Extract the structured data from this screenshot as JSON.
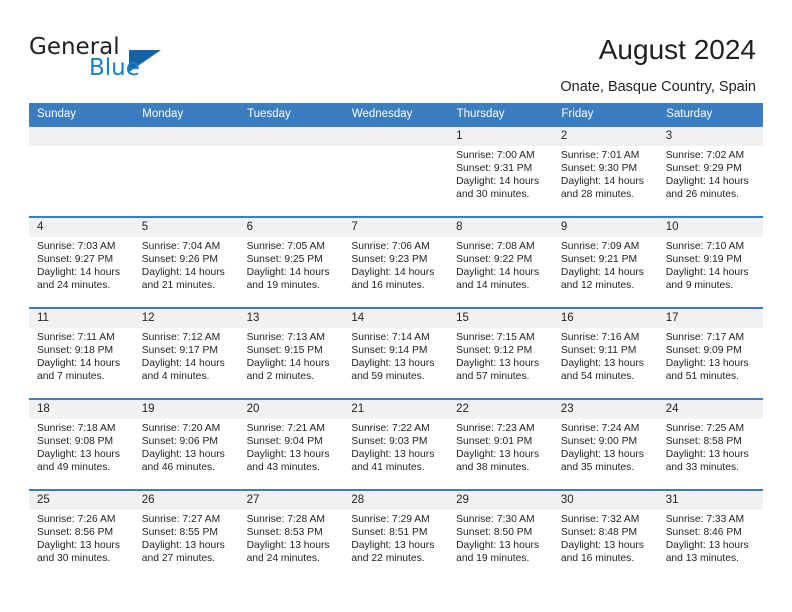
{
  "brand": {
    "name_part1": "General",
    "name_part2": "Blue",
    "triangle_color": "#1464a5",
    "blue_text_color": "#1c7fc4"
  },
  "header": {
    "title": "August 2024",
    "subtitle": "Onate, Basque Country, Spain"
  },
  "theme": {
    "header_row_bg": "#3b7dc0",
    "header_row_text": "#ffffff",
    "daynum_bg": "#f1f1f1",
    "row_divider": "#3b7dc0",
    "body_text": "#231f20"
  },
  "weekday_headers": [
    "Sunday",
    "Monday",
    "Tuesday",
    "Wednesday",
    "Thursday",
    "Friday",
    "Saturday"
  ],
  "weeks": [
    [
      {
        "day": "",
        "empty": true
      },
      {
        "day": "",
        "empty": true
      },
      {
        "day": "",
        "empty": true
      },
      {
        "day": "",
        "empty": true
      },
      {
        "day": "1",
        "sunrise": "Sunrise: 7:00 AM",
        "sunset": "Sunset: 9:31 PM",
        "daylight_line1": "Daylight: 14 hours",
        "daylight_line2": "and 30 minutes."
      },
      {
        "day": "2",
        "sunrise": "Sunrise: 7:01 AM",
        "sunset": "Sunset: 9:30 PM",
        "daylight_line1": "Daylight: 14 hours",
        "daylight_line2": "and 28 minutes."
      },
      {
        "day": "3",
        "sunrise": "Sunrise: 7:02 AM",
        "sunset": "Sunset: 9:29 PM",
        "daylight_line1": "Daylight: 14 hours",
        "daylight_line2": "and 26 minutes."
      }
    ],
    [
      {
        "day": "4",
        "sunrise": "Sunrise: 7:03 AM",
        "sunset": "Sunset: 9:27 PM",
        "daylight_line1": "Daylight: 14 hours",
        "daylight_line2": "and 24 minutes."
      },
      {
        "day": "5",
        "sunrise": "Sunrise: 7:04 AM",
        "sunset": "Sunset: 9:26 PM",
        "daylight_line1": "Daylight: 14 hours",
        "daylight_line2": "and 21 minutes."
      },
      {
        "day": "6",
        "sunrise": "Sunrise: 7:05 AM",
        "sunset": "Sunset: 9:25 PM",
        "daylight_line1": "Daylight: 14 hours",
        "daylight_line2": "and 19 minutes."
      },
      {
        "day": "7",
        "sunrise": "Sunrise: 7:06 AM",
        "sunset": "Sunset: 9:23 PM",
        "daylight_line1": "Daylight: 14 hours",
        "daylight_line2": "and 16 minutes."
      },
      {
        "day": "8",
        "sunrise": "Sunrise: 7:08 AM",
        "sunset": "Sunset: 9:22 PM",
        "daylight_line1": "Daylight: 14 hours",
        "daylight_line2": "and 14 minutes."
      },
      {
        "day": "9",
        "sunrise": "Sunrise: 7:09 AM",
        "sunset": "Sunset: 9:21 PM",
        "daylight_line1": "Daylight: 14 hours",
        "daylight_line2": "and 12 minutes."
      },
      {
        "day": "10",
        "sunrise": "Sunrise: 7:10 AM",
        "sunset": "Sunset: 9:19 PM",
        "daylight_line1": "Daylight: 14 hours",
        "daylight_line2": "and 9 minutes."
      }
    ],
    [
      {
        "day": "11",
        "sunrise": "Sunrise: 7:11 AM",
        "sunset": "Sunset: 9:18 PM",
        "daylight_line1": "Daylight: 14 hours",
        "daylight_line2": "and 7 minutes."
      },
      {
        "day": "12",
        "sunrise": "Sunrise: 7:12 AM",
        "sunset": "Sunset: 9:17 PM",
        "daylight_line1": "Daylight: 14 hours",
        "daylight_line2": "and 4 minutes."
      },
      {
        "day": "13",
        "sunrise": "Sunrise: 7:13 AM",
        "sunset": "Sunset: 9:15 PM",
        "daylight_line1": "Daylight: 14 hours",
        "daylight_line2": "and 2 minutes."
      },
      {
        "day": "14",
        "sunrise": "Sunrise: 7:14 AM",
        "sunset": "Sunset: 9:14 PM",
        "daylight_line1": "Daylight: 13 hours",
        "daylight_line2": "and 59 minutes."
      },
      {
        "day": "15",
        "sunrise": "Sunrise: 7:15 AM",
        "sunset": "Sunset: 9:12 PM",
        "daylight_line1": "Daylight: 13 hours",
        "daylight_line2": "and 57 minutes."
      },
      {
        "day": "16",
        "sunrise": "Sunrise: 7:16 AM",
        "sunset": "Sunset: 9:11 PM",
        "daylight_line1": "Daylight: 13 hours",
        "daylight_line2": "and 54 minutes."
      },
      {
        "day": "17",
        "sunrise": "Sunrise: 7:17 AM",
        "sunset": "Sunset: 9:09 PM",
        "daylight_line1": "Daylight: 13 hours",
        "daylight_line2": "and 51 minutes."
      }
    ],
    [
      {
        "day": "18",
        "sunrise": "Sunrise: 7:18 AM",
        "sunset": "Sunset: 9:08 PM",
        "daylight_line1": "Daylight: 13 hours",
        "daylight_line2": "and 49 minutes."
      },
      {
        "day": "19",
        "sunrise": "Sunrise: 7:20 AM",
        "sunset": "Sunset: 9:06 PM",
        "daylight_line1": "Daylight: 13 hours",
        "daylight_line2": "and 46 minutes."
      },
      {
        "day": "20",
        "sunrise": "Sunrise: 7:21 AM",
        "sunset": "Sunset: 9:04 PM",
        "daylight_line1": "Daylight: 13 hours",
        "daylight_line2": "and 43 minutes."
      },
      {
        "day": "21",
        "sunrise": "Sunrise: 7:22 AM",
        "sunset": "Sunset: 9:03 PM",
        "daylight_line1": "Daylight: 13 hours",
        "daylight_line2": "and 41 minutes."
      },
      {
        "day": "22",
        "sunrise": "Sunrise: 7:23 AM",
        "sunset": "Sunset: 9:01 PM",
        "daylight_line1": "Daylight: 13 hours",
        "daylight_line2": "and 38 minutes."
      },
      {
        "day": "23",
        "sunrise": "Sunrise: 7:24 AM",
        "sunset": "Sunset: 9:00 PM",
        "daylight_line1": "Daylight: 13 hours",
        "daylight_line2": "and 35 minutes."
      },
      {
        "day": "24",
        "sunrise": "Sunrise: 7:25 AM",
        "sunset": "Sunset: 8:58 PM",
        "daylight_line1": "Daylight: 13 hours",
        "daylight_line2": "and 33 minutes."
      }
    ],
    [
      {
        "day": "25",
        "sunrise": "Sunrise: 7:26 AM",
        "sunset": "Sunset: 8:56 PM",
        "daylight_line1": "Daylight: 13 hours",
        "daylight_line2": "and 30 minutes."
      },
      {
        "day": "26",
        "sunrise": "Sunrise: 7:27 AM",
        "sunset": "Sunset: 8:55 PM",
        "daylight_line1": "Daylight: 13 hours",
        "daylight_line2": "and 27 minutes."
      },
      {
        "day": "27",
        "sunrise": "Sunrise: 7:28 AM",
        "sunset": "Sunset: 8:53 PM",
        "daylight_line1": "Daylight: 13 hours",
        "daylight_line2": "and 24 minutes."
      },
      {
        "day": "28",
        "sunrise": "Sunrise: 7:29 AM",
        "sunset": "Sunset: 8:51 PM",
        "daylight_line1": "Daylight: 13 hours",
        "daylight_line2": "and 22 minutes."
      },
      {
        "day": "29",
        "sunrise": "Sunrise: 7:30 AM",
        "sunset": "Sunset: 8:50 PM",
        "daylight_line1": "Daylight: 13 hours",
        "daylight_line2": "and 19 minutes."
      },
      {
        "day": "30",
        "sunrise": "Sunrise: 7:32 AM",
        "sunset": "Sunset: 8:48 PM",
        "daylight_line1": "Daylight: 13 hours",
        "daylight_line2": "and 16 minutes."
      },
      {
        "day": "31",
        "sunrise": "Sunrise: 7:33 AM",
        "sunset": "Sunset: 8:46 PM",
        "daylight_line1": "Daylight: 13 hours",
        "daylight_line2": "and 13 minutes."
      }
    ]
  ]
}
